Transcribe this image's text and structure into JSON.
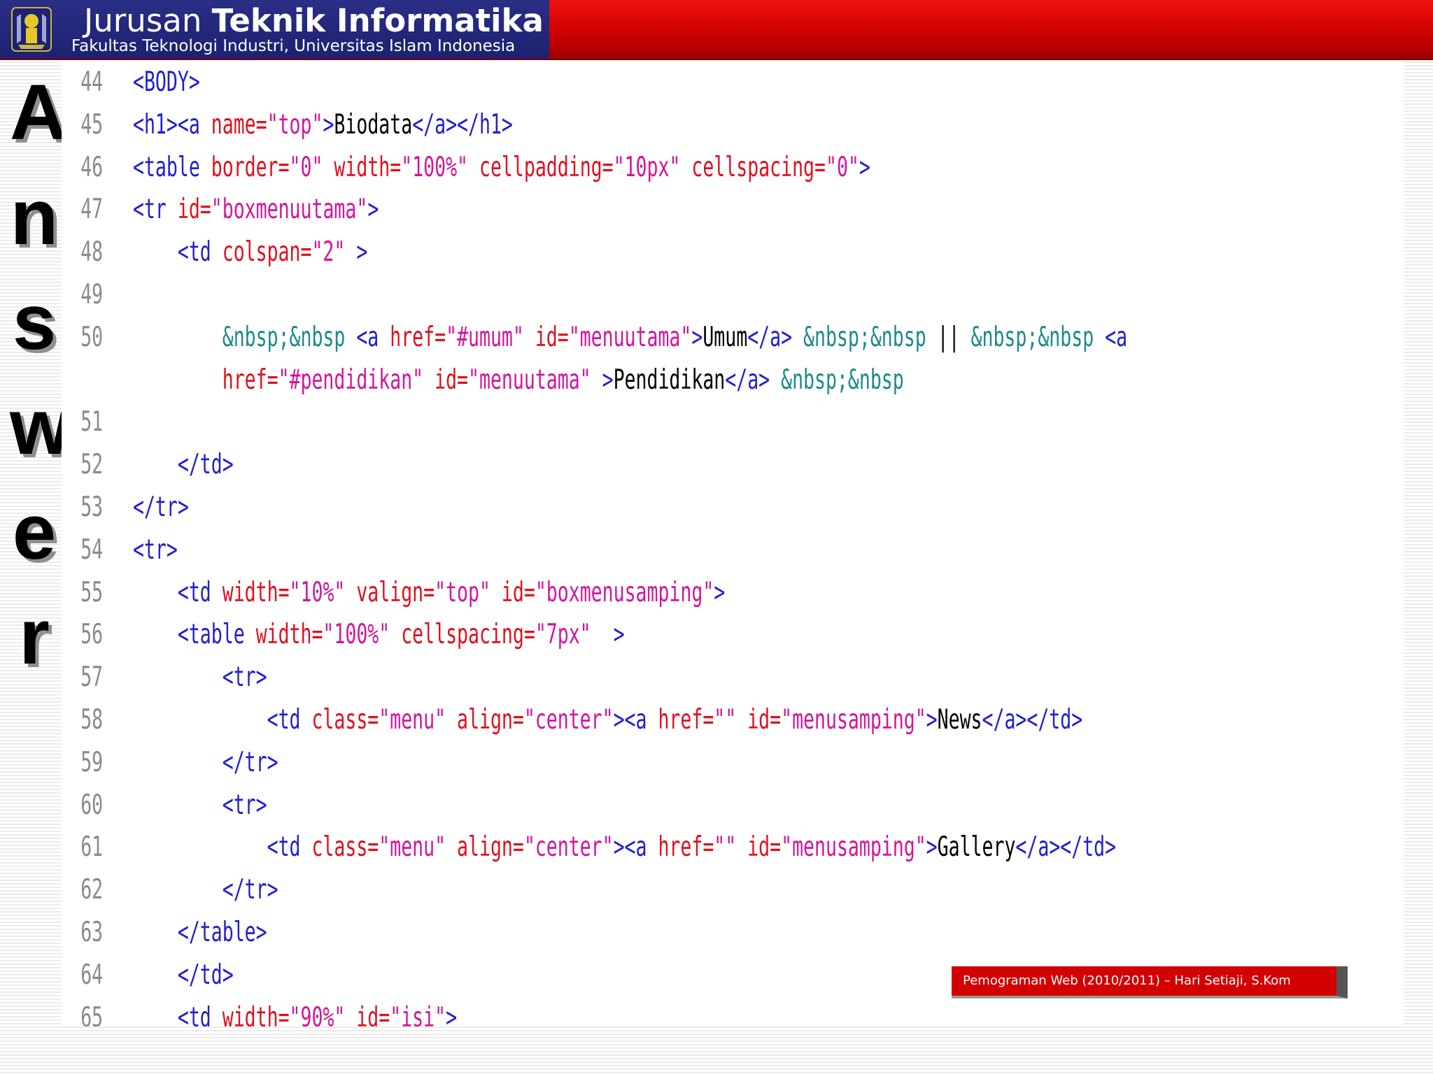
{
  "header": {
    "title_prefix": "Jurusan ",
    "title_bold": "Teknik Informatika",
    "subtitle": "Fakultas Teknologi Industri, Universitas Islam Indonesia",
    "logo_icon": "university-emblem-icon",
    "colors": {
      "brand_bg": "#1d2170",
      "bar_red": "#d00000"
    }
  },
  "side_word": [
    "A",
    "n",
    "s",
    "w",
    "e",
    "r"
  ],
  "code": {
    "colors": {
      "tag": "#2020d0",
      "attr": "#e0101e",
      "value": "#d4149b",
      "entity": "#1c8a8a",
      "text": "#000000",
      "line_number": "#8a8a8a"
    },
    "lines": [
      {
        "n": "44",
        "parts": [
          {
            "c": "t",
            "s": "<BODY>"
          }
        ]
      },
      {
        "n": "45",
        "parts": [
          {
            "c": "t",
            "s": "<h1><a "
          },
          {
            "c": "a",
            "s": "name="
          },
          {
            "c": "v",
            "s": "\"top\""
          },
          {
            "c": "t",
            "s": ">"
          },
          {
            "c": "x",
            "s": "Biodata"
          },
          {
            "c": "t",
            "s": "</a></h1>"
          }
        ]
      },
      {
        "n": "46",
        "parts": [
          {
            "c": "t",
            "s": "<table "
          },
          {
            "c": "a",
            "s": "border="
          },
          {
            "c": "v",
            "s": "\"0\" "
          },
          {
            "c": "a",
            "s": "width="
          },
          {
            "c": "v",
            "s": "\"100%\" "
          },
          {
            "c": "a",
            "s": "cellpadding="
          },
          {
            "c": "v",
            "s": "\"10px\" "
          },
          {
            "c": "a",
            "s": "cellspacing="
          },
          {
            "c": "v",
            "s": "\"0\""
          },
          {
            "c": "t",
            "s": ">"
          }
        ]
      },
      {
        "n": "47",
        "parts": [
          {
            "c": "t",
            "s": "<tr "
          },
          {
            "c": "a",
            "s": "id="
          },
          {
            "c": "v",
            "s": "\"boxmenuutama\""
          },
          {
            "c": "t",
            "s": ">"
          }
        ]
      },
      {
        "n": "48",
        "parts": [
          {
            "c": "t",
            "s": "    <td "
          },
          {
            "c": "a",
            "s": "colspan="
          },
          {
            "c": "v",
            "s": "\"2\" "
          },
          {
            "c": "t",
            "s": ">"
          }
        ]
      },
      {
        "n": "49",
        "parts": []
      },
      {
        "n": "50",
        "parts": [
          {
            "c": "e",
            "s": "        &nbsp;&nbsp "
          },
          {
            "c": "t",
            "s": "<a "
          },
          {
            "c": "a",
            "s": "href="
          },
          {
            "c": "v",
            "s": "\"#umum\" "
          },
          {
            "c": "a",
            "s": "id="
          },
          {
            "c": "v",
            "s": "\"menuutama\""
          },
          {
            "c": "t",
            "s": ">"
          },
          {
            "c": "x",
            "s": "Umum"
          },
          {
            "c": "t",
            "s": "</a> "
          },
          {
            "c": "e",
            "s": "&nbsp;&nbsp "
          },
          {
            "c": "x",
            "s": "|| "
          },
          {
            "c": "e",
            "s": "&nbsp;&nbsp "
          },
          {
            "c": "t",
            "s": "<a"
          }
        ]
      },
      {
        "n": "",
        "parts": [
          {
            "c": "a",
            "s": "        href="
          },
          {
            "c": "v",
            "s": "\"#pendidikan\" "
          },
          {
            "c": "a",
            "s": "id="
          },
          {
            "c": "v",
            "s": "\"menuutama\" "
          },
          {
            "c": "t",
            "s": ">"
          },
          {
            "c": "x",
            "s": "Pendidikan"
          },
          {
            "c": "t",
            "s": "</a> "
          },
          {
            "c": "e",
            "s": "&nbsp;&nbsp"
          }
        ]
      },
      {
        "n": "51",
        "parts": []
      },
      {
        "n": "52",
        "parts": [
          {
            "c": "t",
            "s": "    </td>"
          }
        ]
      },
      {
        "n": "53",
        "parts": [
          {
            "c": "t",
            "s": "</tr>"
          }
        ]
      },
      {
        "n": "54",
        "parts": [
          {
            "c": "t",
            "s": "<tr>"
          }
        ]
      },
      {
        "n": "55",
        "parts": [
          {
            "c": "t",
            "s": "    <td "
          },
          {
            "c": "a",
            "s": "width="
          },
          {
            "c": "v",
            "s": "\"10%\" "
          },
          {
            "c": "a",
            "s": "valign="
          },
          {
            "c": "v",
            "s": "\"top\" "
          },
          {
            "c": "a",
            "s": "id="
          },
          {
            "c": "v",
            "s": "\"boxmenusamping\""
          },
          {
            "c": "t",
            "s": ">"
          }
        ]
      },
      {
        "n": "56",
        "parts": [
          {
            "c": "t",
            "s": "    <table "
          },
          {
            "c": "a",
            "s": "width="
          },
          {
            "c": "v",
            "s": "\"100%\" "
          },
          {
            "c": "a",
            "s": "cellspacing="
          },
          {
            "c": "v",
            "s": "\"7px\"  "
          },
          {
            "c": "t",
            "s": ">"
          }
        ]
      },
      {
        "n": "57",
        "parts": [
          {
            "c": "t",
            "s": "        <tr>"
          }
        ]
      },
      {
        "n": "58",
        "parts": [
          {
            "c": "t",
            "s": "            <td "
          },
          {
            "c": "a",
            "s": "class="
          },
          {
            "c": "v",
            "s": "\"menu\" "
          },
          {
            "c": "a",
            "s": "align="
          },
          {
            "c": "v",
            "s": "\"center\""
          },
          {
            "c": "t",
            "s": "><a "
          },
          {
            "c": "a",
            "s": "href="
          },
          {
            "c": "v",
            "s": "\"\" "
          },
          {
            "c": "a",
            "s": "id="
          },
          {
            "c": "v",
            "s": "\"menusamping\""
          },
          {
            "c": "t",
            "s": ">"
          },
          {
            "c": "x",
            "s": "News"
          },
          {
            "c": "t",
            "s": "</a></td>"
          }
        ]
      },
      {
        "n": "59",
        "parts": [
          {
            "c": "t",
            "s": "        </tr>"
          }
        ]
      },
      {
        "n": "60",
        "parts": [
          {
            "c": "t",
            "s": "        <tr>"
          }
        ]
      },
      {
        "n": "61",
        "parts": [
          {
            "c": "t",
            "s": "            <td "
          },
          {
            "c": "a",
            "s": "class="
          },
          {
            "c": "v",
            "s": "\"menu\" "
          },
          {
            "c": "a",
            "s": "align="
          },
          {
            "c": "v",
            "s": "\"center\""
          },
          {
            "c": "t",
            "s": "><a "
          },
          {
            "c": "a",
            "s": "href="
          },
          {
            "c": "v",
            "s": "\"\" "
          },
          {
            "c": "a",
            "s": "id="
          },
          {
            "c": "v",
            "s": "\"menusamping\""
          },
          {
            "c": "t",
            "s": ">"
          },
          {
            "c": "x",
            "s": "Gallery"
          },
          {
            "c": "t",
            "s": "</a></td>"
          }
        ]
      },
      {
        "n": "62",
        "parts": [
          {
            "c": "t",
            "s": "        </tr>"
          }
        ]
      },
      {
        "n": "63",
        "parts": [
          {
            "c": "t",
            "s": "    </table>"
          }
        ]
      },
      {
        "n": "64",
        "parts": [
          {
            "c": "t",
            "s": "    </td>"
          }
        ]
      },
      {
        "n": "65",
        "parts": [
          {
            "c": "t",
            "s": "    <td "
          },
          {
            "c": "a",
            "s": "width="
          },
          {
            "c": "v",
            "s": "\"90%\" "
          },
          {
            "c": "a",
            "s": "id="
          },
          {
            "c": "v",
            "s": "\"isi\""
          },
          {
            "c": "t",
            "s": ">"
          }
        ]
      }
    ]
  },
  "footer": {
    "text": "Pemograman Web (2010/2011) – Hari Setiaji, S.Kom"
  }
}
